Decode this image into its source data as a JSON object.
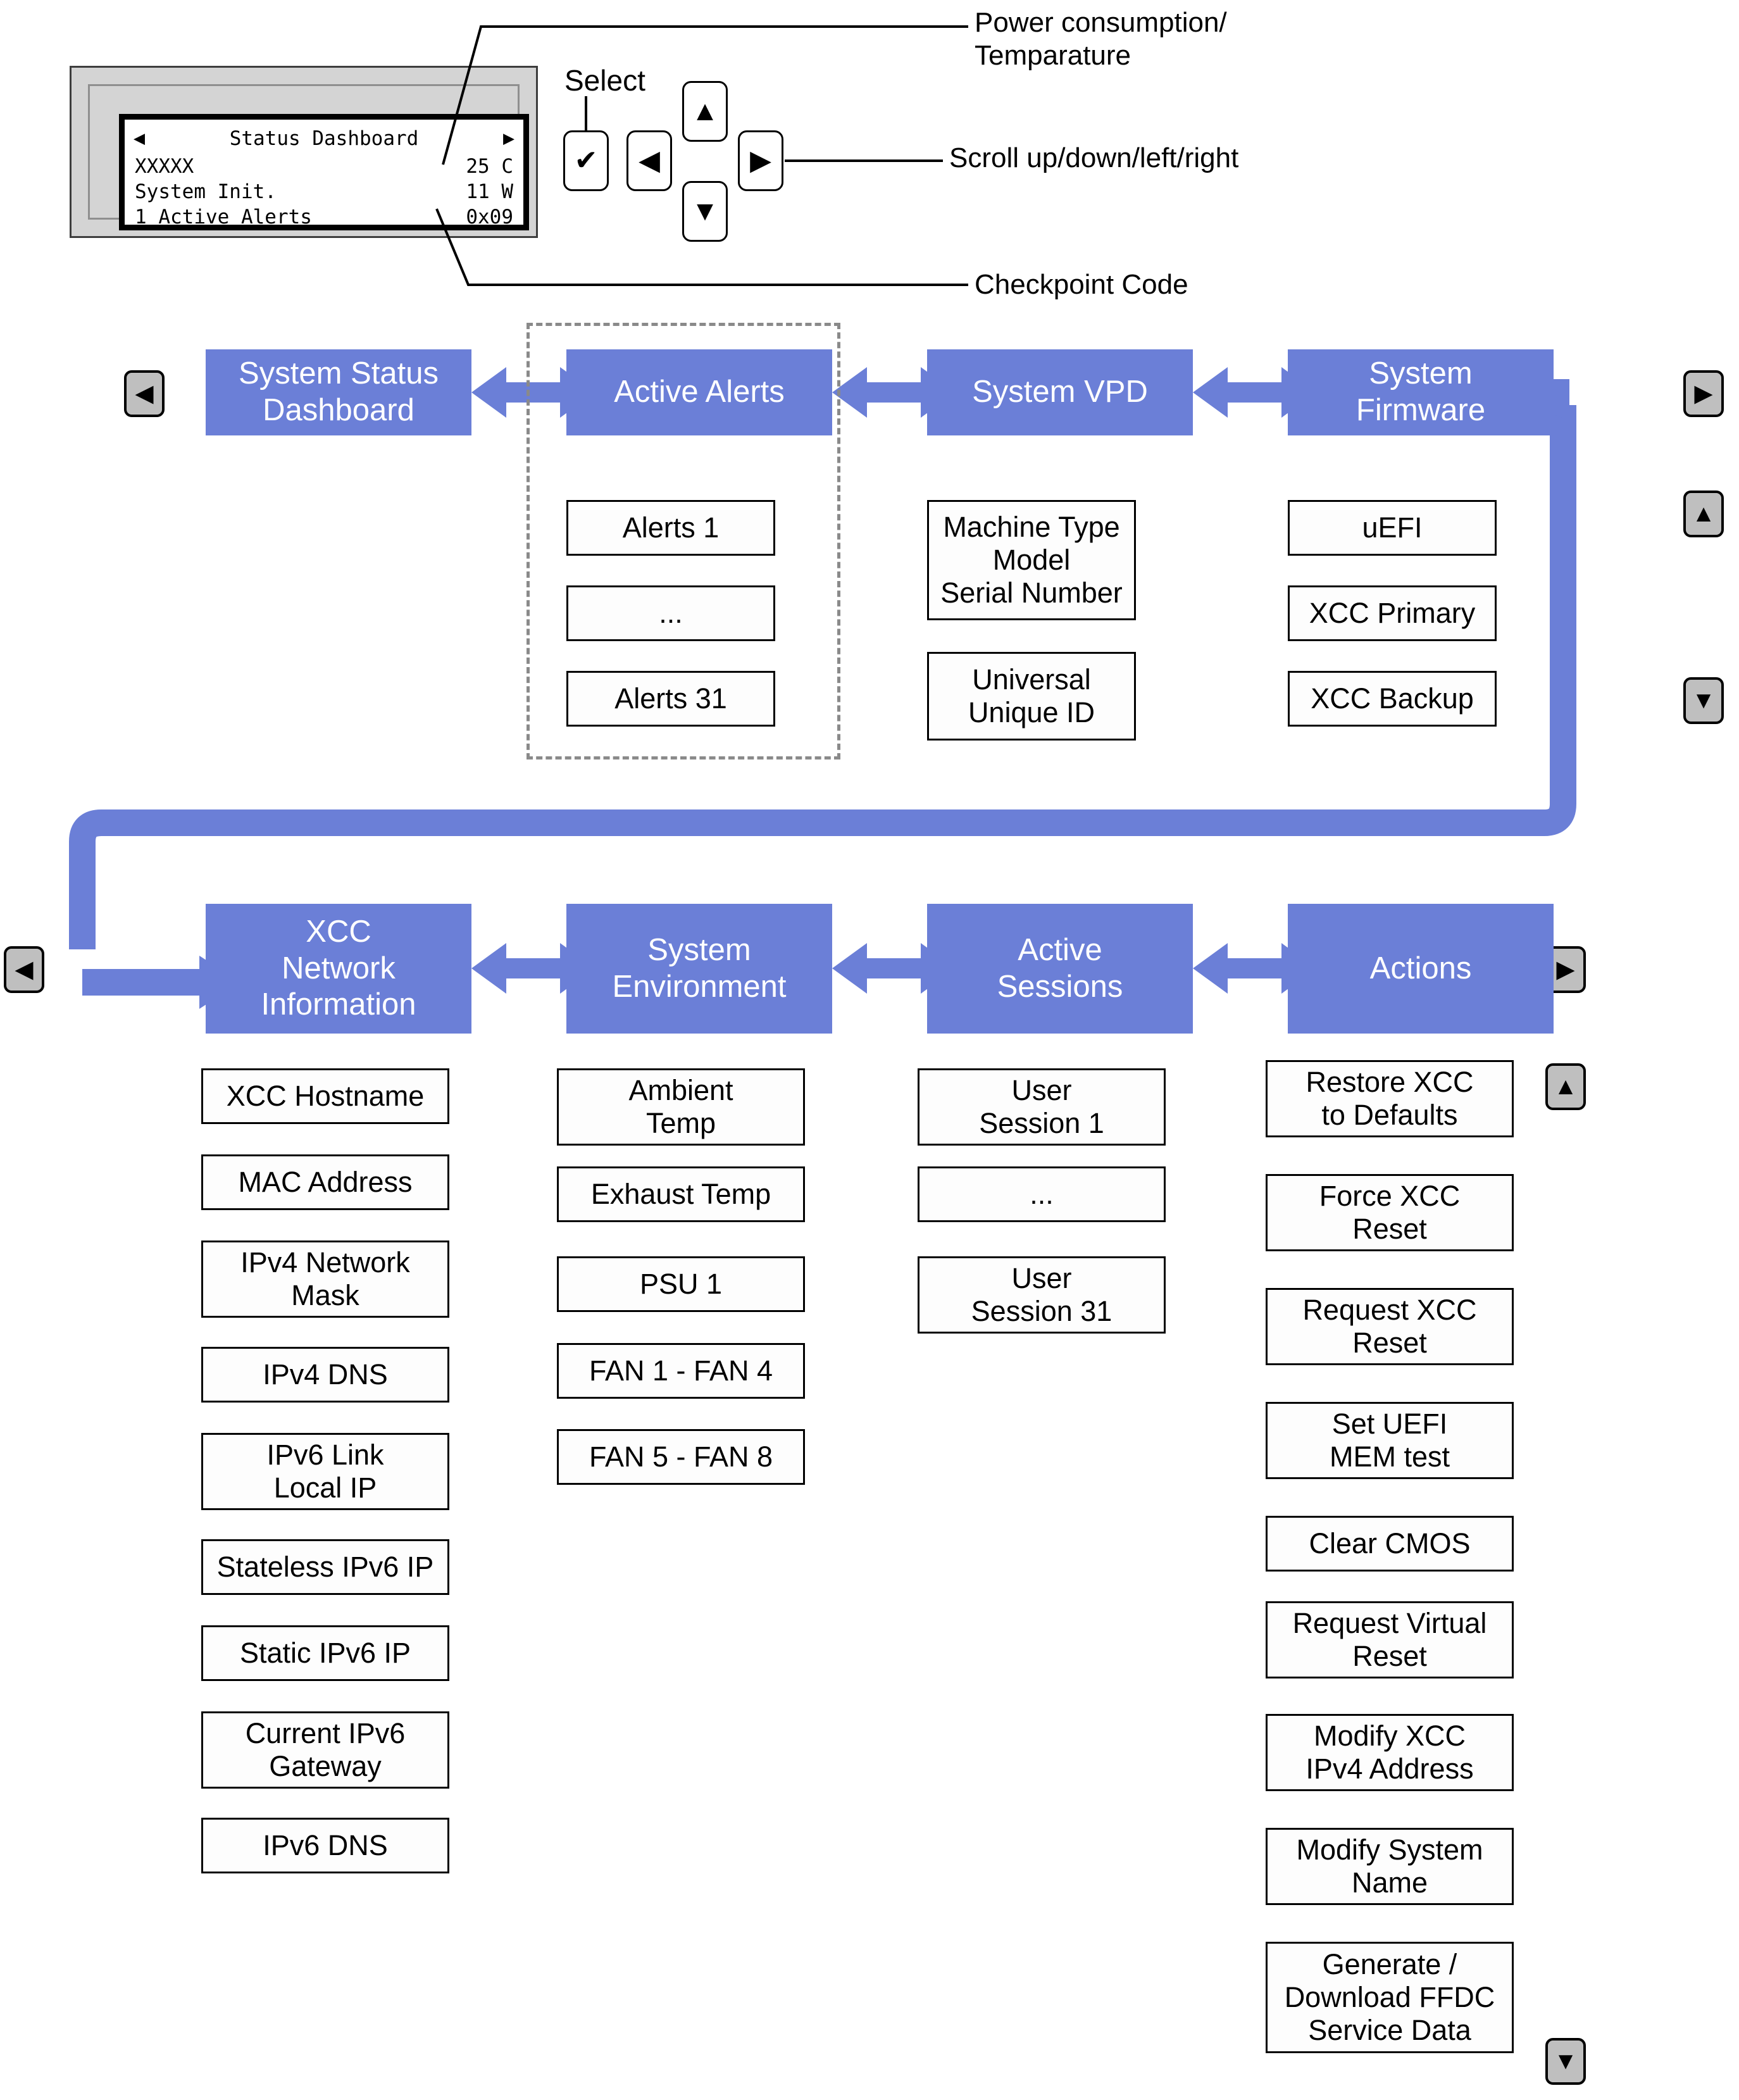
{
  "lcd": {
    "nav_left": "◀",
    "nav_right": "▶",
    "title": "Status Dashboard",
    "rows": [
      {
        "left": "XXXXX",
        "right": "25 C"
      },
      {
        "left": "System Init.",
        "right": "11 W"
      },
      {
        "left": "1 Active Alerts",
        "right": "0x09"
      }
    ]
  },
  "controls": {
    "select_label": "Select",
    "select_glyph": "✔",
    "up_glyph": "▲",
    "left_glyph": "◀",
    "right_glyph": "▶",
    "down_glyph": "▼"
  },
  "callouts": {
    "power_temp": "Power consumption/\nTemparature",
    "power_temp_l1": "Power consumption/",
    "power_temp_l2": "Temparature",
    "scroll": "Scroll up/down/left/right",
    "checkpoint": "Checkpoint Code"
  },
  "nav_keys": {
    "row1_left": "◀",
    "row1_right": "▶",
    "row1_up": "▲",
    "row1_down": "▼",
    "row2_left": "◀",
    "row2_right": "▶",
    "row2_up": "▲",
    "row2_down": "▼"
  },
  "colors": {
    "header_blue": "#6B7FD7",
    "arrow_blue": "#6B7FD7",
    "dashed_gray": "#8a8a8a",
    "keycap_gray": "#bfbfbf"
  },
  "row1": {
    "columns": [
      {
        "title": "System Status\nDashboard",
        "title_l1": "System Status",
        "title_l2": "Dashboard",
        "items": []
      },
      {
        "title": "Active Alerts",
        "title_l1": "Active Alerts",
        "title_l2": "",
        "items": [
          "Alerts 1",
          "...",
          "Alerts 31"
        ]
      },
      {
        "title": "System VPD",
        "title_l1": "System VPD",
        "title_l2": "",
        "items": [
          "Machine Type\nModel\nSerial Number",
          "Universal\nUnique ID"
        ],
        "item_lines": [
          [
            "Machine Type",
            "Model",
            "Serial Number"
          ],
          [
            "Universal",
            "Unique ID"
          ]
        ]
      },
      {
        "title": "System\nFirmware",
        "title_l1": "System",
        "title_l2": "Firmware",
        "items": [
          "uEFI",
          "XCC Primary",
          "XCC Backup"
        ]
      }
    ]
  },
  "row2": {
    "columns": [
      {
        "title": "XCC\nNetwork\nInformation",
        "title_l1": "XCC",
        "title_l2": "Network",
        "title_l3": "Information",
        "items": [
          "XCC Hostname",
          "MAC Address",
          "IPv4 Network\nMask",
          "IPv4 DNS",
          "IPv6 Link\nLocal IP",
          "Stateless IPv6 IP",
          "Static IPv6 IP",
          "Current IPv6\nGateway",
          "IPv6 DNS"
        ]
      },
      {
        "title": "System\nEnvironment",
        "title_l1": "System",
        "title_l2": "Environment",
        "items": [
          "Ambient\nTemp",
          "Exhaust Temp",
          "PSU 1",
          "FAN 1 - FAN 4",
          "FAN 5 - FAN 8"
        ]
      },
      {
        "title": "Active\nSessions",
        "title_l1": "Active",
        "title_l2": "Sessions",
        "items": [
          "User\nSession 1",
          "...",
          "User\nSession 31"
        ]
      },
      {
        "title": "Actions",
        "title_l1": "Actions",
        "title_l2": "",
        "items": [
          "Restore XCC\nto Defaults",
          "Force XCC\nReset",
          "Request XCC\nReset",
          "Set UEFI\nMEM test",
          "Clear CMOS",
          "Request Virtual\nReset",
          "Modify XCC\nIPv4 Address",
          "Modify System\nName",
          "Generate /\nDownload FFDC\nService Data"
        ]
      }
    ]
  }
}
